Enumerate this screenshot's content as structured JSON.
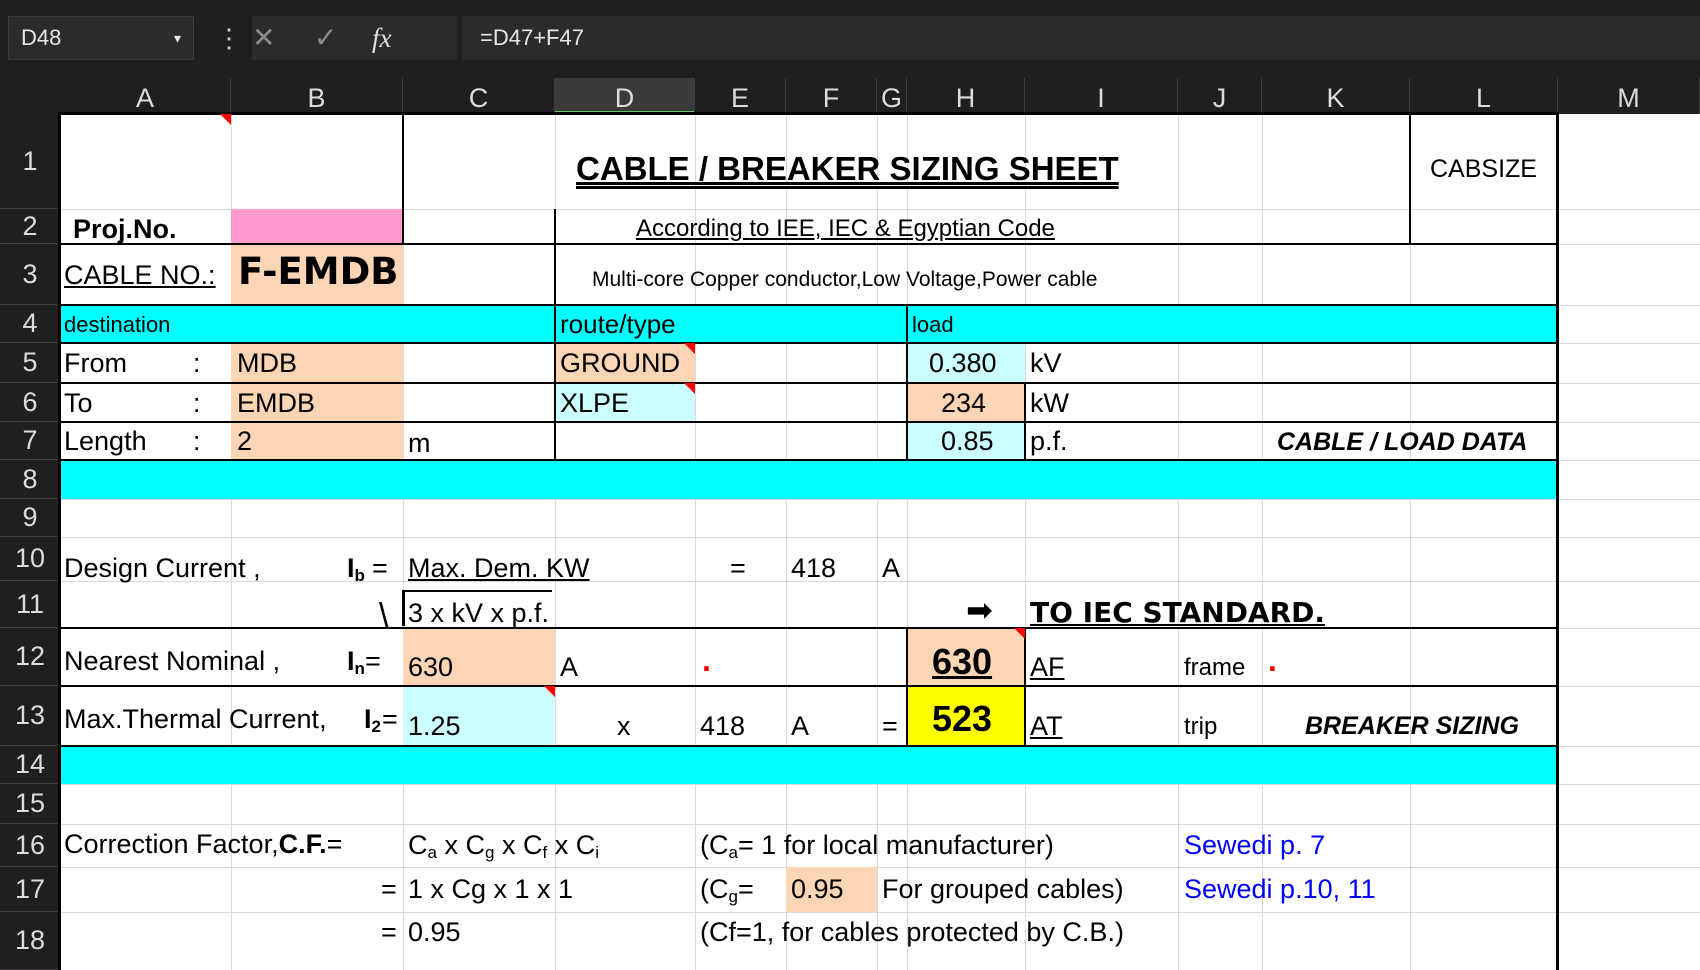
{
  "formula_bar": {
    "name_box": "D48",
    "name_caret": "▾",
    "more": "⋮",
    "cancel": "✕",
    "enter": "✓",
    "fx": "fx",
    "formula": "=D47+F47"
  },
  "columns": [
    "A",
    "B",
    "C",
    "D",
    "E",
    "F",
    "G",
    "H",
    "I",
    "J",
    "K",
    "L",
    "M"
  ],
  "rows": [
    "1",
    "2",
    "3",
    "4",
    "5",
    "6",
    "7",
    "8",
    "9",
    "10",
    "11",
    "12",
    "13",
    "14",
    "15",
    "16",
    "17",
    "18"
  ],
  "sheet": {
    "title": "CABLE / BREAKER SIZING SHEET",
    "subtitle": "According to IEE, IEC & Egyptian Code",
    "code": "CABSIZE",
    "proj_label": "Proj.No.",
    "cable_no_label": "CABLE NO.:",
    "cable_no": "F-EMDB",
    "cable_desc": "Multi-core Copper conductor,Low Voltage,Power cable",
    "destination": "destination",
    "route_type": "route/type",
    "load": "load",
    "from_label": "From",
    "to_label": "To",
    "length_label": "Length",
    "colon": ":",
    "from": "MDB",
    "to": "EMDB",
    "length": "2",
    "length_unit": "m",
    "route": "GROUND",
    "type": "XLPE",
    "kv": "0.380",
    "kv_unit": "kV",
    "kw": "234",
    "kw_unit": "kW",
    "pf": "0.85",
    "pf_unit": "p.f.",
    "cable_load_data": "CABLE / LOAD DATA",
    "design_current_label": "Design Current ,",
    "ib_sym": "I",
    "ib_sub": "b",
    "eq": "=",
    "max_dem": "Max. Dem. KW",
    "design_eq": "=",
    "design_value": "418",
    "amp": "A",
    "sqrt_sign": "\\",
    "denominator": "3 x kV x p.f.",
    "arrow": "➡",
    "to_iec": "TO IEC STANDARD.",
    "nearest_label": "Nearest Nominal ,",
    "in_sym": "I",
    "in_sub": "n",
    "nearest_value": "630",
    "nearest_unit": "A",
    "dot": ".",
    "af_value": "630",
    "af": "AF",
    "frame": "frame",
    "thermal_label": "Max.Thermal Current,",
    "i2_sym": "I",
    "i2_sub": "2",
    "thermal_factor": "1.25",
    "times": "x",
    "thermal_base": "418",
    "thermal_unit": "A",
    "thermal_eq": "=",
    "at_value": "523",
    "at": "AT",
    "trip": "trip",
    "breaker_sizing": "BREAKER SIZING",
    "cf_label": "Correction Factor,",
    "cf_bold": "C.F.",
    "cf_eq": "=",
    "cf_formula": {
      "c": "C",
      "a": "a",
      "x": " x ",
      "g": "g",
      "f": "f",
      "i": "i"
    },
    "row17_eq": "=",
    "row17_formula": "1 x Cg x 1 x 1",
    "row18_eq": "=",
    "row18_value": "0.95",
    "ca_note_open": "(C",
    "ca_note_sub": "a",
    "ca_note_rest": "= 1 for local manufacturer)",
    "cg_note_open": "(C",
    "cg_note_sub": "g",
    "cg_note_eq": "=",
    "cg_value": "0.95",
    "cg_note_rest": "For grouped cables)",
    "cf_note": "(Cf=1, for cables protected by C.B.)",
    "ref1": "Sewedi p. 7",
    "ref2": "Sewedi p.10, 11"
  },
  "colors": {
    "cyan": "#00ffff",
    "peach": "#fcd5b4",
    "light_cyan": "#ccffff",
    "pink": "#ff99cc",
    "yellow": "#ffff00",
    "link_blue": "#0000ff"
  }
}
